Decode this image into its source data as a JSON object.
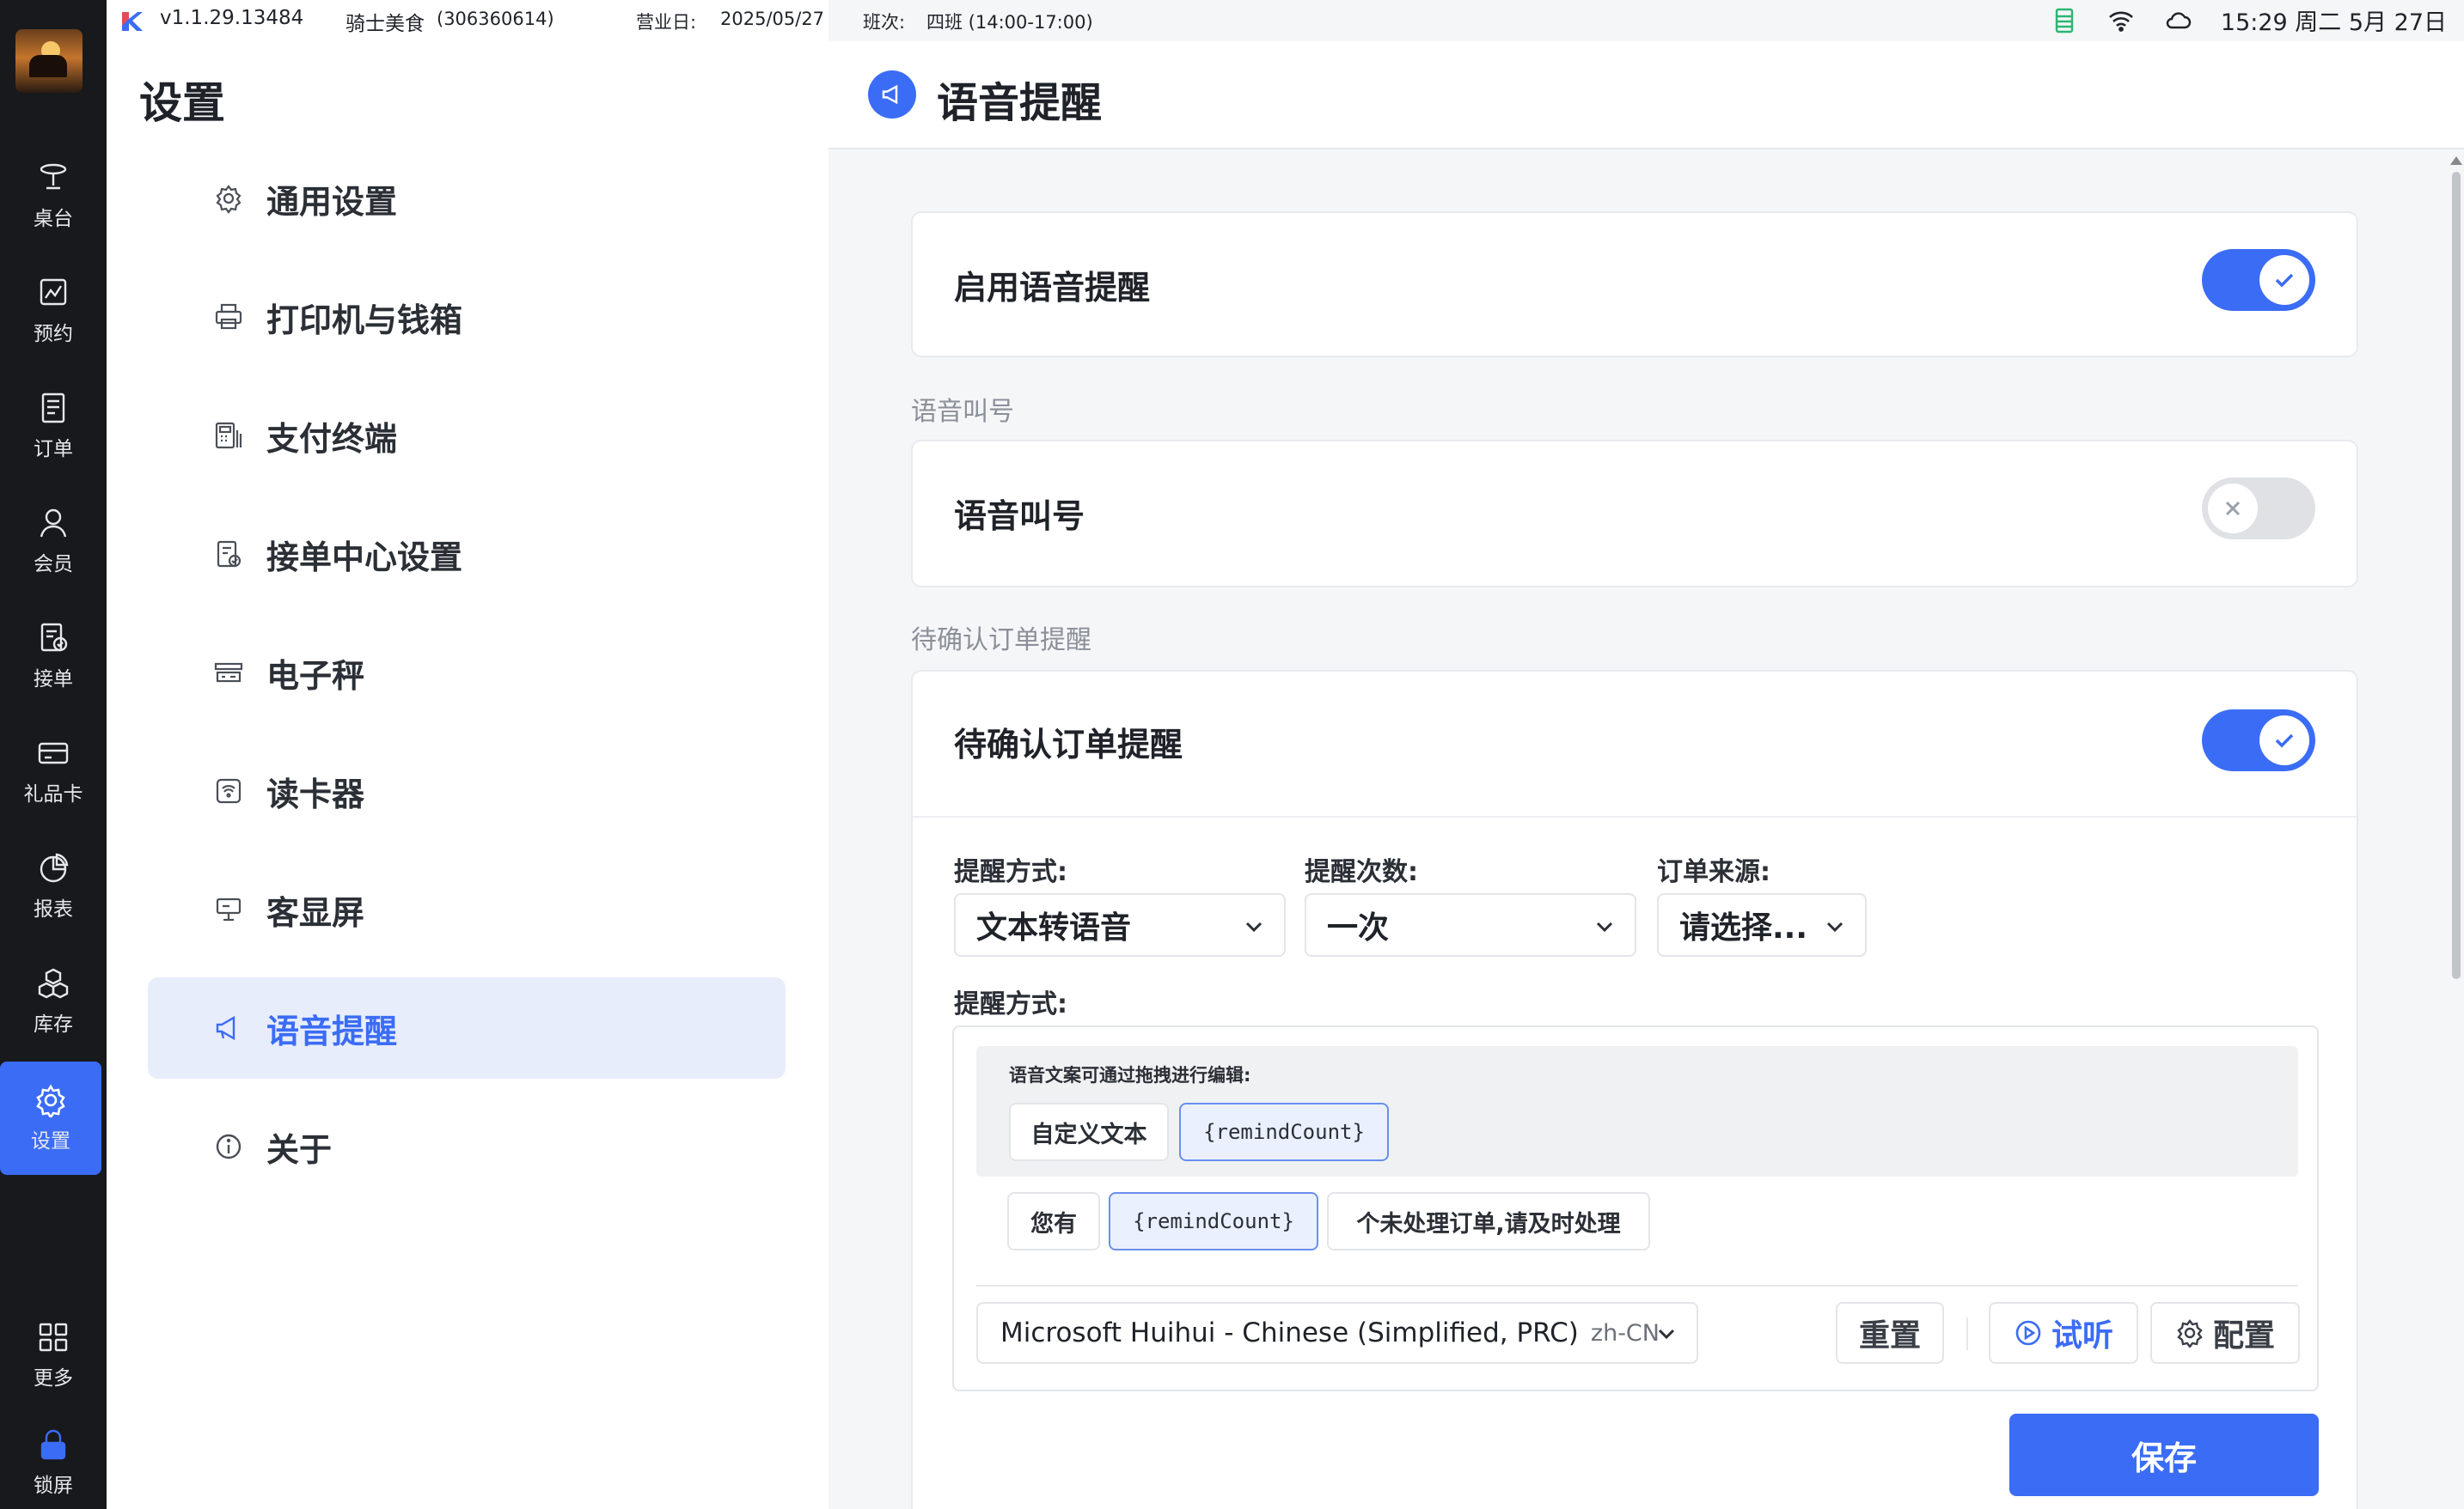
{
  "topbar": {
    "version": "v1.1.29.13484",
    "store": "骑士美食",
    "store_id": "(306360614)",
    "business_day_label": "营业日:",
    "business_day": "2025/05/27",
    "shift_label": "班次:",
    "shift": "四班 (14:00-17:00)",
    "clock": "15:29 周二 5月 27日",
    "icons": [
      "calculator-icon",
      "wifi-icon",
      "cloud-icon"
    ]
  },
  "rail": {
    "items": [
      {
        "label": "桌台",
        "icon": "table-icon"
      },
      {
        "label": "预约",
        "icon": "reservation-icon"
      },
      {
        "label": "订单",
        "icon": "order-icon"
      },
      {
        "label": "会员",
        "icon": "member-icon"
      },
      {
        "label": "接单",
        "icon": "accept-order-icon"
      },
      {
        "label": "礼品卡",
        "icon": "giftcard-icon"
      },
      {
        "label": "报表",
        "icon": "report-icon"
      },
      {
        "label": "库存",
        "icon": "inventory-icon"
      },
      {
        "label": "设置",
        "icon": "settings-icon",
        "active": true
      },
      {
        "label": "更多",
        "icon": "grid-icon"
      },
      {
        "label": "锁屏",
        "icon": "lock-icon"
      }
    ]
  },
  "menu": {
    "title": "设置",
    "items": [
      {
        "label": "通用设置",
        "icon": "gear-icon"
      },
      {
        "label": "打印机与钱箱",
        "icon": "printer-icon"
      },
      {
        "label": "支付终端",
        "icon": "pos-terminal-icon"
      },
      {
        "label": "接单中心设置",
        "icon": "document-check-icon"
      },
      {
        "label": "电子秤",
        "icon": "scale-icon"
      },
      {
        "label": "读卡器",
        "icon": "card-reader-icon"
      },
      {
        "label": "客显屏",
        "icon": "customer-display-icon"
      },
      {
        "label": "语音提醒",
        "icon": "megaphone-icon",
        "active": true
      },
      {
        "label": "关于",
        "icon": "info-icon"
      }
    ]
  },
  "content": {
    "title": "语音提醒",
    "enable_voice": {
      "label": "启用语音提醒",
      "on": true
    },
    "calling_section_label": "语音叫号",
    "calling": {
      "label": "语音叫号",
      "on": false
    },
    "pending_section_label": "待确认订单提醒",
    "pending": {
      "label": "待确认订单提醒",
      "on": true,
      "mode_label": "提醒方式:",
      "mode_value": "文本转语音",
      "count_label": "提醒次数:",
      "count_value": "一次",
      "source_label": "订单来源:",
      "source_value": "请选择...",
      "text_mode_label": "提醒方式:",
      "editor_hint": "语音文案可通过拖拽进行编辑:",
      "palette_chips": [
        "自定义文本",
        "{remindCount}"
      ],
      "sentence_chips": [
        "您有",
        "{remindCount}",
        "个未处理订单,请及时处理"
      ],
      "voice": "Microsoft Huihui - Chinese (Simplified, PRC)",
      "voice_locale": "zh-CN",
      "reset_label": "重置",
      "preview_label": "试听",
      "config_label": "配置",
      "save_label": "保存"
    }
  }
}
